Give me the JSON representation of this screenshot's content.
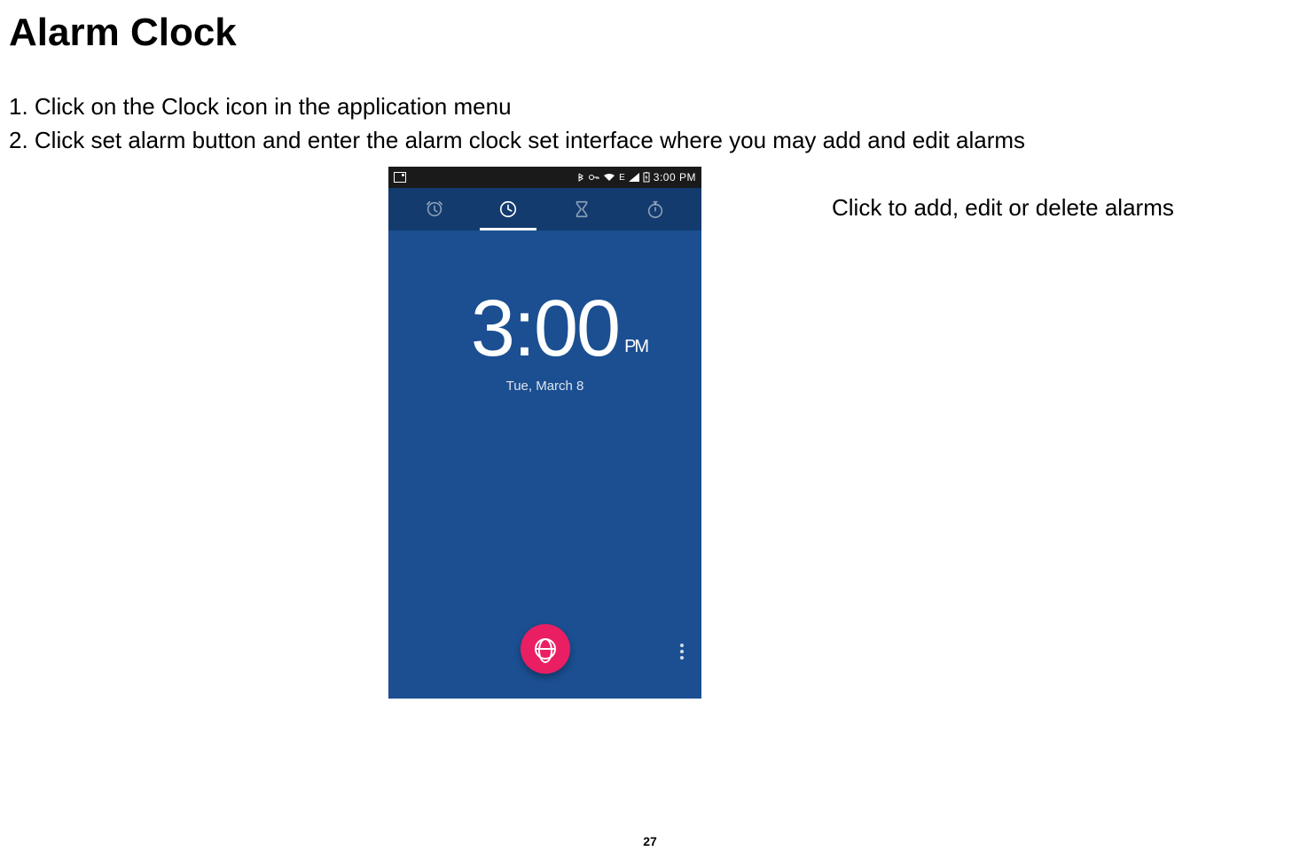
{
  "title": "Alarm Clock",
  "instructions": {
    "step1": "1. Click on the Clock icon in the application menu",
    "step2": "2. Click set alarm button and enter the alarm clock set interface where you may add and edit alarms"
  },
  "annotation": "Click to add, edit or delete alarms",
  "page_number": "27",
  "phone": {
    "status_time": "3:00 PM",
    "status_network": "E",
    "clock": {
      "time": "3:00",
      "ampm": "PM",
      "date": "Tue, March 8"
    }
  }
}
